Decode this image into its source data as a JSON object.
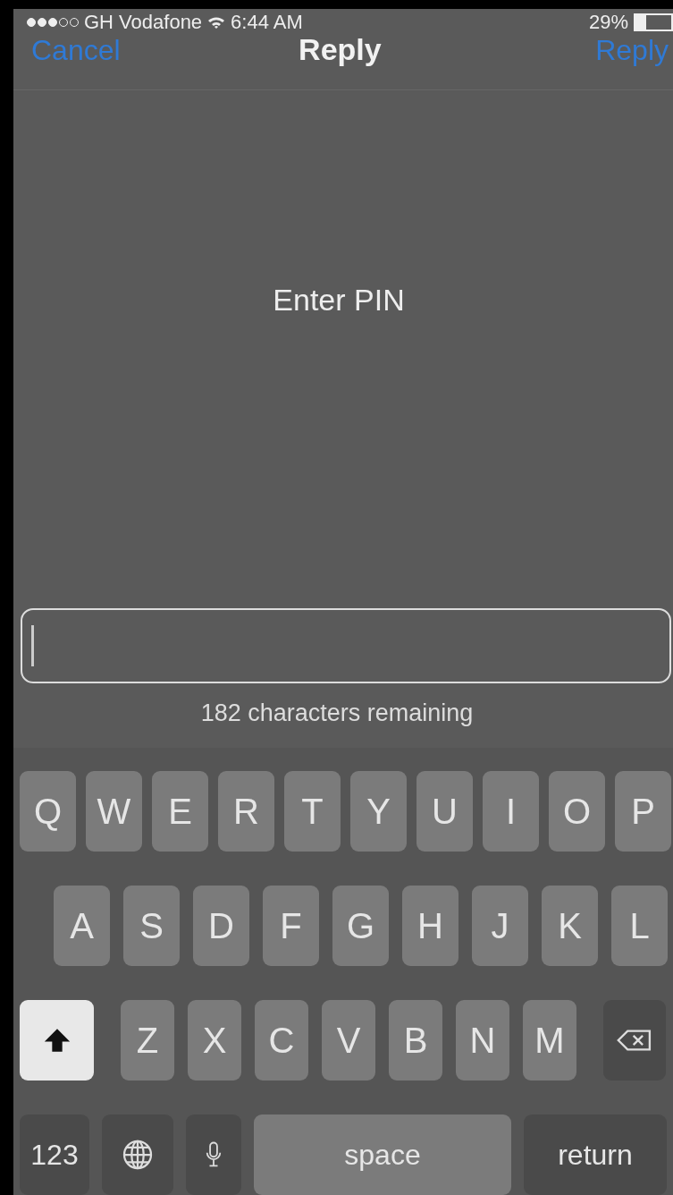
{
  "status_bar": {
    "carrier": "GH Vodafone",
    "time": "6:44 AM",
    "battery": "29%"
  },
  "nav_bar": {
    "cancel": "Cancel",
    "title": "Reply",
    "action": "Reply"
  },
  "prompt": "Enter PIN",
  "reply_field": {
    "focused": true
  },
  "counter": "182 characters remaining",
  "keyboard": {
    "rows": [
      {
        "keys": [
          {
            "kind": "letter",
            "label": "Q"
          },
          {
            "kind": "letter",
            "label": "W"
          },
          {
            "kind": "letter",
            "label": "E"
          },
          {
            "kind": "letter",
            "label": "R"
          },
          {
            "kind": "letter",
            "label": "T"
          },
          {
            "kind": "letter",
            "label": "Y"
          },
          {
            "kind": "letter",
            "label": "U"
          },
          {
            "kind": "letter",
            "label": "I"
          },
          {
            "kind": "letter",
            "label": "O"
          },
          {
            "kind": "letter",
            "label": "P"
          }
        ]
      },
      {
        "keys": [
          {
            "kind": "letter",
            "label": "A"
          },
          {
            "kind": "letter",
            "label": "S"
          },
          {
            "kind": "letter",
            "label": "D"
          },
          {
            "kind": "letter",
            "label": "F"
          },
          {
            "kind": "letter",
            "label": "G"
          },
          {
            "kind": "letter",
            "label": "H"
          },
          {
            "kind": "letter",
            "label": "J"
          },
          {
            "kind": "letter",
            "label": "K"
          },
          {
            "kind": "letter",
            "label": "L"
          }
        ]
      },
      {
        "keys": [
          {
            "kind": "shift"
          },
          {
            "kind": "letter",
            "label": "Z"
          },
          {
            "kind": "letter",
            "label": "X"
          },
          {
            "kind": "letter",
            "label": "C"
          },
          {
            "kind": "letter",
            "label": "V"
          },
          {
            "kind": "letter",
            "label": "B"
          },
          {
            "kind": "letter",
            "label": "N"
          },
          {
            "kind": "letter",
            "label": "M"
          },
          {
            "kind": "delete"
          }
        ]
      },
      {
        "keys": [
          {
            "kind": "numbers",
            "label": "123"
          },
          {
            "kind": "globe"
          },
          {
            "kind": "mic"
          },
          {
            "kind": "space",
            "label": "space"
          },
          {
            "kind": "return",
            "label": "return"
          }
        ]
      }
    ]
  }
}
